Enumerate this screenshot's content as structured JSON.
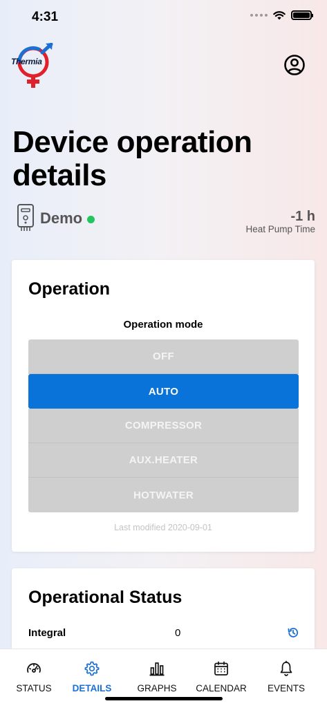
{
  "status_bar": {
    "time": "4:31"
  },
  "brand": {
    "logo_text": "Thermia"
  },
  "page": {
    "title": "Device operation details"
  },
  "device": {
    "name": "Demo",
    "online": true,
    "heat_pump_time": "-1 h",
    "heat_pump_time_label": "Heat Pump Time"
  },
  "operation": {
    "title": "Operation",
    "mode_label": "Operation mode",
    "modes": [
      {
        "label": "OFF",
        "selected": false
      },
      {
        "label": "AUTO",
        "selected": true
      },
      {
        "label": "COMPRESSOR",
        "selected": false
      },
      {
        "label": "AUX.HEATER",
        "selected": false
      },
      {
        "label": "HOTWATER",
        "selected": false
      }
    ],
    "last_modified": "Last modified 2020-09-01"
  },
  "operational_status": {
    "title": "Operational Status",
    "rows": [
      {
        "label": "Integral",
        "value": "0"
      }
    ]
  },
  "tabs": [
    {
      "label": "STATUS",
      "icon": "gauge-icon",
      "active": false
    },
    {
      "label": "DETAILS",
      "icon": "gear-icon",
      "active": true
    },
    {
      "label": "GRAPHS",
      "icon": "bar-chart-icon",
      "active": false
    },
    {
      "label": "CALENDAR",
      "icon": "calendar-icon",
      "active": false
    },
    {
      "label": "EVENTS",
      "icon": "bell-icon",
      "active": false
    }
  ],
  "colors": {
    "accent": "#0a73d9",
    "online": "#22c55e",
    "inactive_mode": "#cfcfcf",
    "logo_red": "#e0202a",
    "logo_blue": "#1d6fd1"
  }
}
